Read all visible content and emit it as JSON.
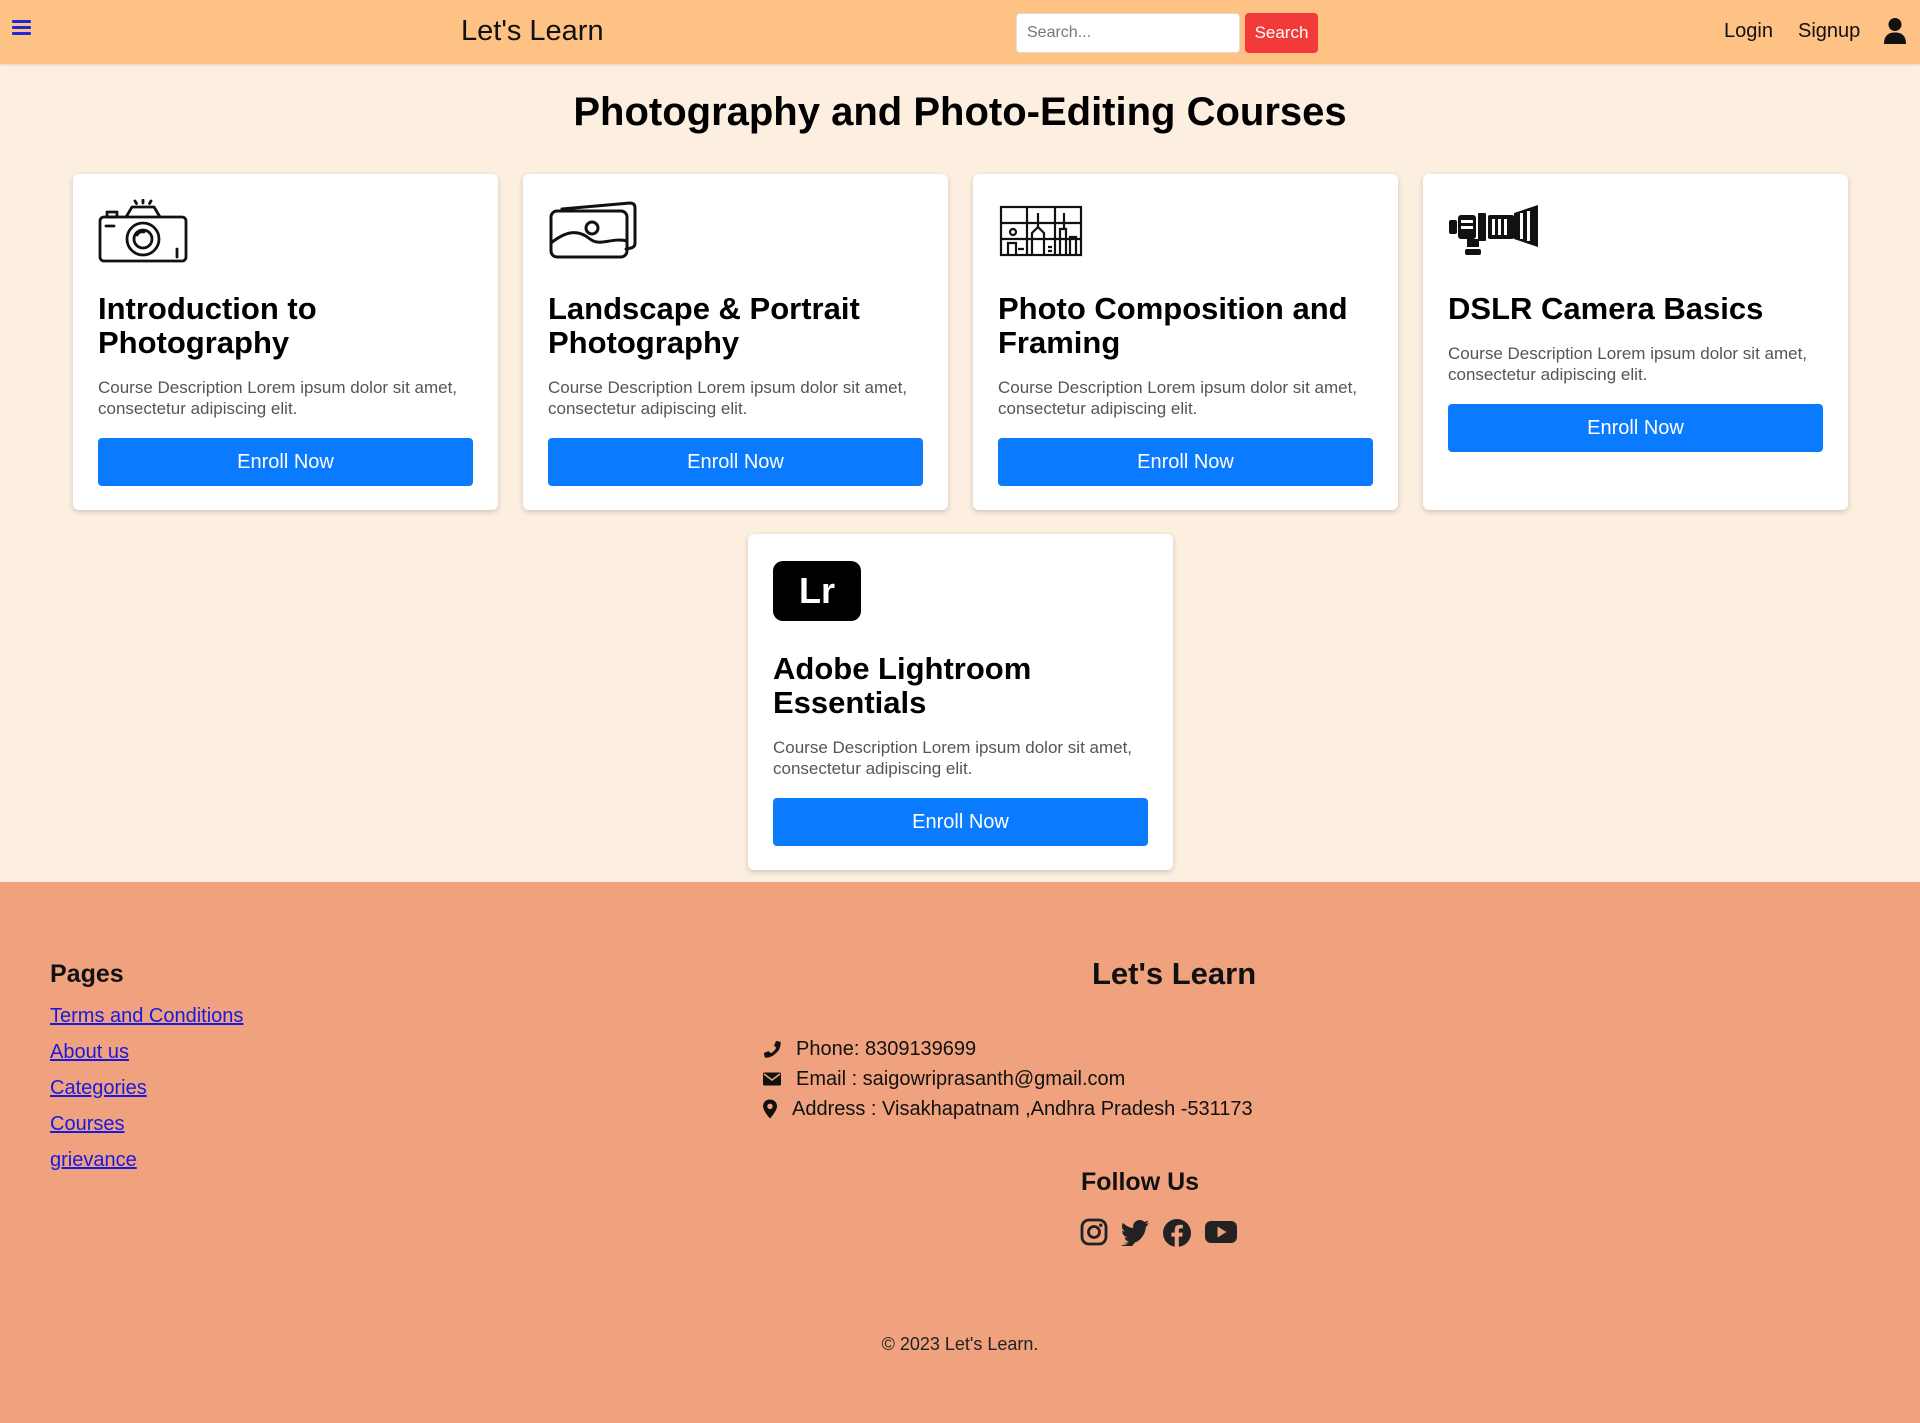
{
  "navbar": {
    "brand": "Let's Learn",
    "search_placeholder": "Search...",
    "search_button": "Search",
    "login": "Login",
    "signup": "Signup"
  },
  "page_title": "Photography and Photo-Editing Courses",
  "courses": [
    {
      "title": "Introduction to Photography",
      "icon": "camera-icon",
      "description": "Course Description Lorem ipsum dolor sit amet, consectetur adipiscing elit.",
      "button": "Enroll Now"
    },
    {
      "title": "Landscape & Portrait Photography",
      "icon": "photos-icon",
      "description": "Course Description Lorem ipsum dolor sit amet, consectetur adipiscing elit.",
      "button": "Enroll Now"
    },
    {
      "title": "Photo Composition and Framing",
      "icon": "composition-grid-icon",
      "description": "Course Description Lorem ipsum dolor sit amet, consectetur adipiscing elit.",
      "button": "Enroll Now"
    },
    {
      "title": "DSLR Camera Basics",
      "icon": "video-camera-icon",
      "description": "Course Description Lorem ipsum dolor sit amet, consectetur adipiscing elit.",
      "button": "Enroll Now"
    },
    {
      "title": "Adobe Lightroom Essentials",
      "icon": "lightroom-icon",
      "icon_text": "Lr",
      "description": "Course Description Lorem ipsum dolor sit amet, consectetur adipiscing elit.",
      "button": "Enroll Now"
    }
  ],
  "footer": {
    "pages_title": "Pages",
    "pages": [
      "Terms and Conditions",
      "About us",
      "Categories",
      "Courses",
      "grievance"
    ],
    "brand": "Let's Learn",
    "phone": "Phone: 8309139699",
    "email": "Email : saigowriprasanth@gmail.com",
    "address": "Address : Visakhapatnam ,Andhra Pradesh -531173",
    "follow_title": "Follow Us",
    "socials": [
      "instagram-icon",
      "twitter-icon",
      "facebook-icon",
      "youtube-icon"
    ],
    "copyright": "© 2023 Let's Learn."
  },
  "colors": {
    "navbar_bg": "#fdc284",
    "page_bg": "#fdefe0",
    "footer_bg": "#efa27d",
    "button_blue": "#0a7bff",
    "search_red": "#f23a3a",
    "link_blue": "#1a1adf"
  }
}
